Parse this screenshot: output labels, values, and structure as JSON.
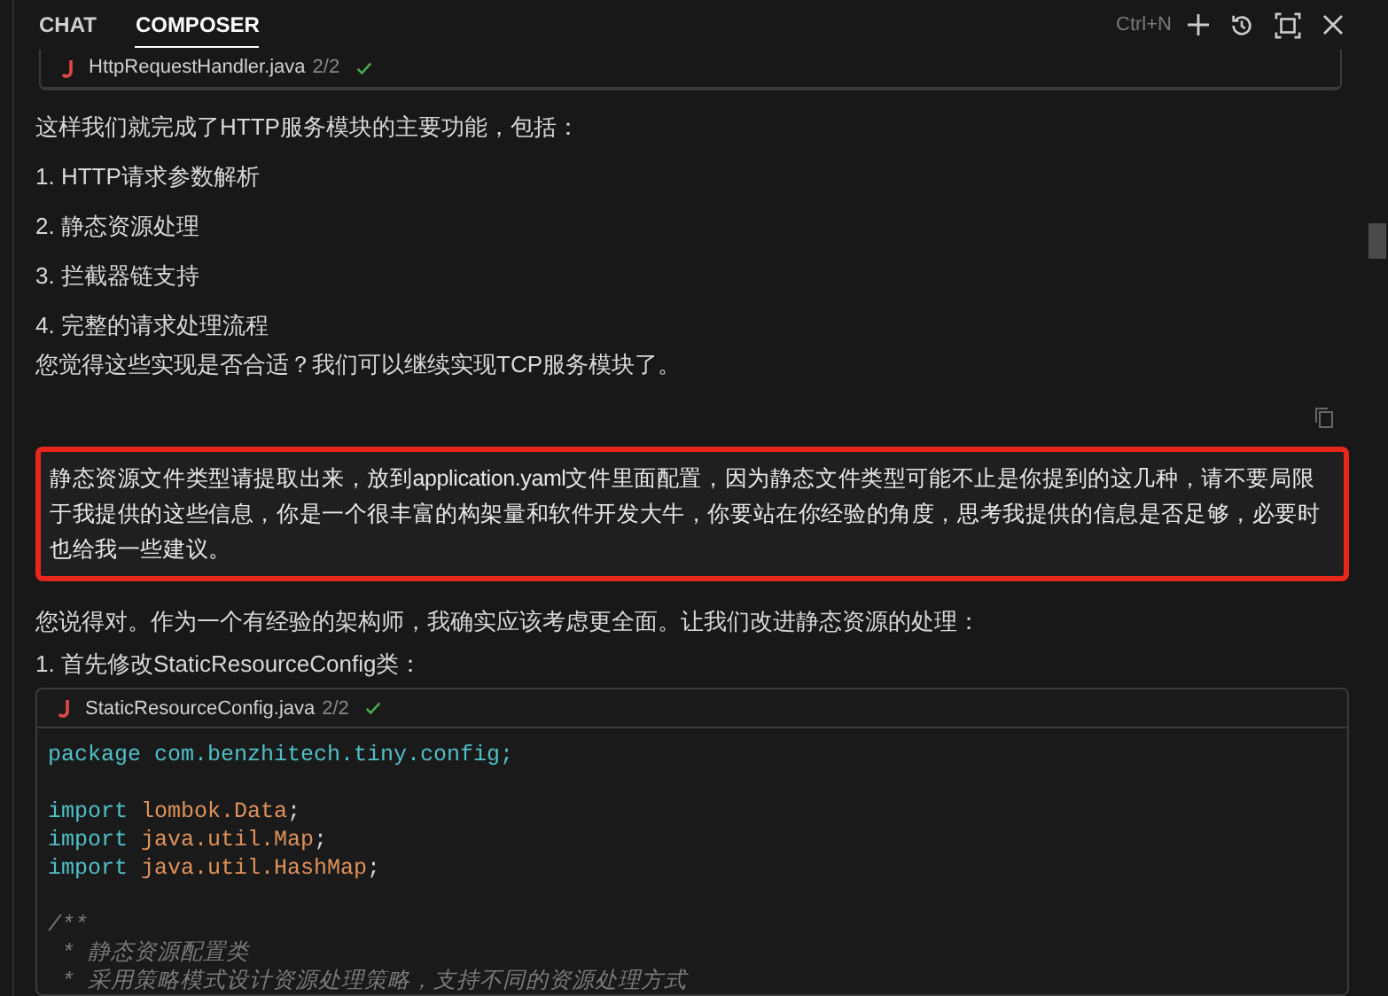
{
  "tabs": [
    {
      "label": "CHAT",
      "selected": false
    },
    {
      "label": "COMPOSER",
      "selected": true
    }
  ],
  "shortcut": "Ctrl+N",
  "top_file": {
    "name": "HttpRequestHandler.java",
    "count": "2/2",
    "applied": true
  },
  "reply_1": {
    "intro": "这样我们就完成了HTTP服务模块的主要功能，包括：",
    "items": [
      "1. HTTP请求参数解析",
      "2. 静态资源处理",
      "3. 拦截器链支持",
      "4. 完整的请求处理流程"
    ],
    "outro": "您觉得这些实现是否合适？我们可以继续实现TCP服务模块了。"
  },
  "user_message": {
    "text": "静态资源文件类型请提取出来，放到application.yaml文件里面配置，因为静态文件类型可能不止是你提到的这几种，请不要局限于我提供的这些信息，你是一个很丰富的构架量和软件开发大牛，你要站在你经验的角度，思考我提供的信息是否足够，必要时也给我一些建议。",
    "highlighted": true
  },
  "reply_2": {
    "intro": "您说得对。作为一个有经验的架构师，我确实应该考虑更全面。让我们改进静态资源的处理：",
    "step": "1. 首先修改StaticResourceConfig类："
  },
  "code_file": {
    "name": "StaticResourceConfig.java",
    "count": "2/2",
    "applied": true,
    "lines": [
      [
        {
          "kind": "keyword",
          "text": "package com.benzhitech.tiny.config;"
        }
      ],
      {
        "kind": "blank"
      },
      [
        {
          "kind": "keyword",
          "text": "import "
        },
        {
          "kind": "name",
          "text": "lombok.Data"
        },
        {
          "kind": "plain",
          "text": ";"
        }
      ],
      [
        {
          "kind": "keyword",
          "text": "import "
        },
        {
          "kind": "name",
          "text": "java.util.Map"
        },
        {
          "kind": "plain",
          "text": ";"
        }
      ],
      [
        {
          "kind": "keyword",
          "text": "import "
        },
        {
          "kind": "name",
          "text": "java.util.HashMap"
        },
        {
          "kind": "plain",
          "text": ";"
        }
      ],
      {
        "kind": "blank"
      },
      [
        {
          "kind": "comment",
          "text": "/**"
        }
      ],
      [
        {
          "kind": "comment",
          "text": " * 静态资源配置类"
        }
      ],
      [
        {
          "kind": "comment",
          "text": " * 采用策略模式设计资源处理策略，支持不同的资源处理方式"
        }
      ]
    ]
  }
}
